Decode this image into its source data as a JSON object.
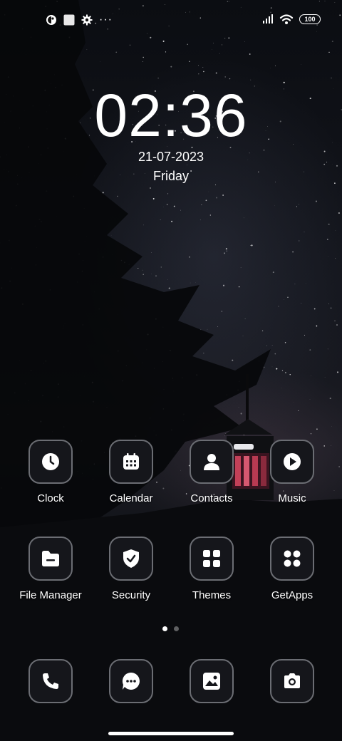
{
  "status_bar": {
    "left_icons": [
      "app-notification-icon",
      "square-notification-icon",
      "settings-gear-icon",
      "more-dots-icon"
    ],
    "more_label": "···",
    "right_icons": [
      "signal-icon",
      "wifi-icon"
    ],
    "battery": "100"
  },
  "lockclock": {
    "time": "02:36",
    "date": "21-07-2023",
    "day": "Friday"
  },
  "home": {
    "row1": [
      {
        "label": "Clock",
        "icon": "clock-icon"
      },
      {
        "label": "Calendar",
        "icon": "calendar-icon"
      },
      {
        "label": "Contacts",
        "icon": "contacts-icon"
      },
      {
        "label": "Music",
        "icon": "play-icon"
      }
    ],
    "row2": [
      {
        "label": "File Manager",
        "icon": "folder-icon"
      },
      {
        "label": "Security",
        "icon": "shield-icon"
      },
      {
        "label": "Themes",
        "icon": "themes-grid-icon"
      },
      {
        "label": "GetApps",
        "icon": "getapps-icon"
      }
    ]
  },
  "page_indicator": {
    "pages": 2,
    "current": 1
  },
  "dock": [
    {
      "icon": "phone-icon"
    },
    {
      "icon": "messages-icon"
    },
    {
      "icon": "gallery-icon"
    },
    {
      "icon": "camera-icon"
    }
  ]
}
